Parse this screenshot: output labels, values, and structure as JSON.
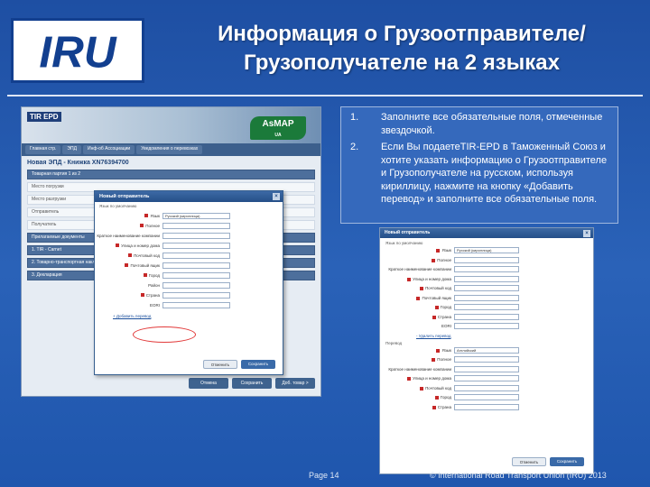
{
  "slide": {
    "title_line1": "Информация о Грузоотправителе/",
    "title_line2": "Грузополучателе на 2 языках",
    "logo_text": "IRU",
    "page_number": "Page 14",
    "copyright": "© International Road Transport Union (IRU) 2013",
    "colors": {
      "background": "#2a62b8",
      "logo_blue": "#123f8f",
      "required_marker": "#c62828",
      "highlight_ellipse": "#e23b3b"
    }
  },
  "instructions": [
    {
      "num": "1.",
      "text": "Заполните все обязательные поля, отмеченные звездочкой."
    },
    {
      "num": "2.",
      "text": "Если Вы подаетеTIR-EPD в Таможенный Союз и хотите указать информацию о Грузоотправителе и Грузополучателе на русском, используя кириллицу, нажмите на кнопку «Добавить перевод» и заполните все обязательные поля."
    }
  ],
  "main_screenshot": {
    "app_logo": "TIR EPD",
    "asmap_logo": "AsMAP",
    "asmap_sub": "UA",
    "nav": [
      "Главная стр.",
      "ЭПД",
      "Инф-об Ассоциации",
      "Уведомления о перевозках"
    ],
    "doc_title": "Новая ЭПД - Книжка XN76394700",
    "rows": [
      "Товарная партия 1 из 2",
      "Место погрузки",
      "Место разгрузки",
      "Отправитель",
      "Получатель",
      "Прилагаемые документы",
      "1. TIR - Carnet",
      "2. Товарно-транспортная накладная",
      "3. Декларация"
    ],
    "buttons": [
      "Отмена",
      "Сохранить",
      "Доб. товар >"
    ]
  },
  "dialog_left": {
    "header": "Новый отправитель",
    "language_label": "Язык по умолчанию",
    "fields": [
      {
        "label": "Язык",
        "value": "Русский (кириллица)",
        "required": true
      },
      {
        "label": "Полное",
        "value": "",
        "required": true
      },
      {
        "label": "Краткое наименование компании",
        "value": "",
        "required": false
      },
      {
        "label": "Улица и номер дома",
        "value": "",
        "required": true
      },
      {
        "label": "Почтовый код",
        "value": "",
        "required": true
      },
      {
        "label": "Почтовый ящик",
        "value": "",
        "required": true
      },
      {
        "label": "Город",
        "value": "",
        "required": true
      },
      {
        "label": "Район",
        "value": "",
        "required": false
      },
      {
        "label": "Страна",
        "value": "",
        "required": true
      },
      {
        "label": "EORI",
        "value": "",
        "required": false
      }
    ],
    "add_translation_link": "+ Добавить перевод",
    "vat_label": "Обязательные поля",
    "cancel_label": "Отменить",
    "save_label": "Сохранить"
  },
  "dialog_right": {
    "header": "Новый отправитель",
    "language_label": "Язык по умолчанию",
    "fields_default": [
      {
        "label": "Язык",
        "value": "Русский (кириллица)",
        "required": true
      },
      {
        "label": "Полное",
        "value": "",
        "required": true
      },
      {
        "label": "Краткое наименование компании",
        "value": "",
        "required": false
      },
      {
        "label": "Улица и номер дома",
        "value": "",
        "required": true
      },
      {
        "label": "Почтовый код",
        "value": "",
        "required": true
      },
      {
        "label": "Почтовый ящик",
        "value": "",
        "required": true
      },
      {
        "label": "Город",
        "value": "",
        "required": true
      },
      {
        "label": "Страна",
        "value": "",
        "required": true
      },
      {
        "label": "EORI",
        "value": "",
        "required": false
      }
    ],
    "delete_translation_link": "- Удалить перевод",
    "translation_label": "Перевод",
    "fields_translation": [
      {
        "label": "Язык",
        "value": "Английский",
        "required": true
      },
      {
        "label": "Полное",
        "value": "",
        "required": true
      },
      {
        "label": "Краткое наименование компании",
        "value": "",
        "required": false
      },
      {
        "label": "Улица и номер дома",
        "value": "",
        "required": true
      },
      {
        "label": "Почтовый код",
        "value": "",
        "required": true
      },
      {
        "label": "Город",
        "value": "",
        "required": true
      },
      {
        "label": "Страна",
        "value": "",
        "required": true
      }
    ],
    "cancel_label": "Отменить",
    "save_label": "Сохранить"
  }
}
